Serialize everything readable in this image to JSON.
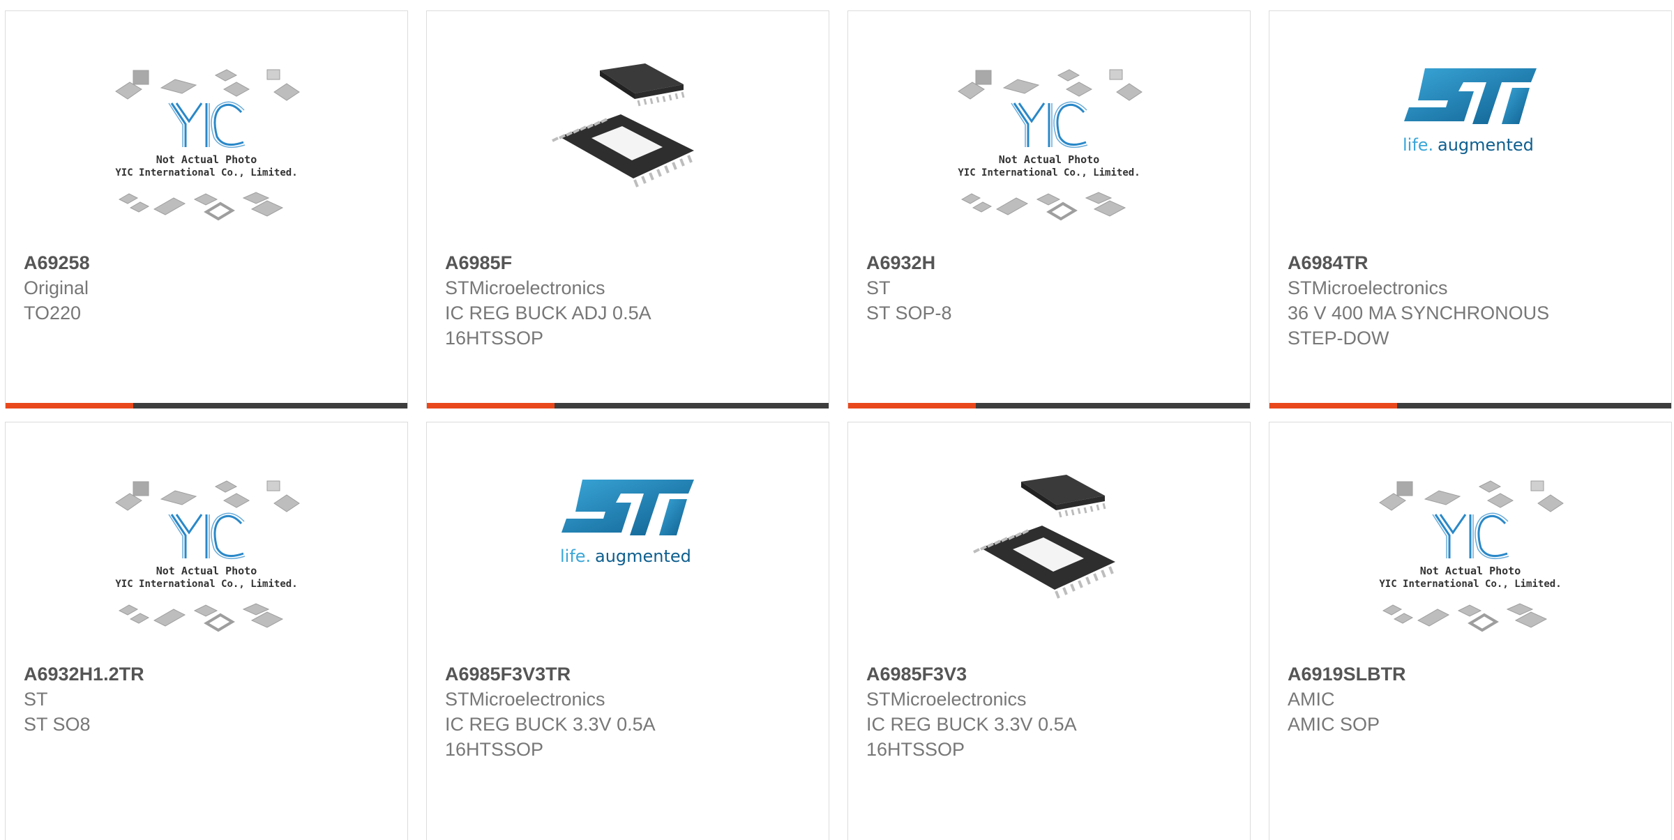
{
  "colors": {
    "accent": "#e8481c",
    "bar": "#3d3d3d",
    "st_blue": "#1a7ab0",
    "yic_blue": "#2a88c8"
  },
  "yic_placeholder": {
    "line1": "Not Actual Photo",
    "line2": "YIC International Co., Limited."
  },
  "st_logo": {
    "brand": "ST",
    "tagline_a": "life.",
    "tagline_b": "augmented"
  },
  "products": [
    {
      "part": "A69258",
      "manufacturer": "Original",
      "desc1": "TO220",
      "desc2": "",
      "image": "yic-placeholder-image"
    },
    {
      "part": "A6985F",
      "manufacturer": "STMicroelectronics",
      "desc1": "IC REG BUCK ADJ 0.5A",
      "desc2": "16HTSSOP",
      "image": "chip-photo-image"
    },
    {
      "part": "A6932H",
      "manufacturer": "ST",
      "desc1": "ST SOP-8",
      "desc2": "",
      "image": "yic-placeholder-image"
    },
    {
      "part": "A6984TR",
      "manufacturer": "STMicroelectronics",
      "desc1": "36 V 400 MA SYNCHRONOUS",
      "desc2": "STEP-DOW",
      "image": "st-logo-image"
    },
    {
      "part": "A6932H1.2TR",
      "manufacturer": "ST",
      "desc1": "ST SO8",
      "desc2": "",
      "image": "yic-placeholder-image"
    },
    {
      "part": "A6985F3V3TR",
      "manufacturer": "STMicroelectronics",
      "desc1": "IC REG BUCK 3.3V 0.5A",
      "desc2": "16HTSSOP",
      "image": "st-logo-image"
    },
    {
      "part": "A6985F3V3",
      "manufacturer": "STMicroelectronics",
      "desc1": "IC REG BUCK 3.3V 0.5A",
      "desc2": "16HTSSOP",
      "image": "chip-photo-image"
    },
    {
      "part": "A6919SLBTR",
      "manufacturer": "AMIC",
      "desc1": "AMIC SOP",
      "desc2": "",
      "image": "yic-placeholder-image"
    }
  ]
}
